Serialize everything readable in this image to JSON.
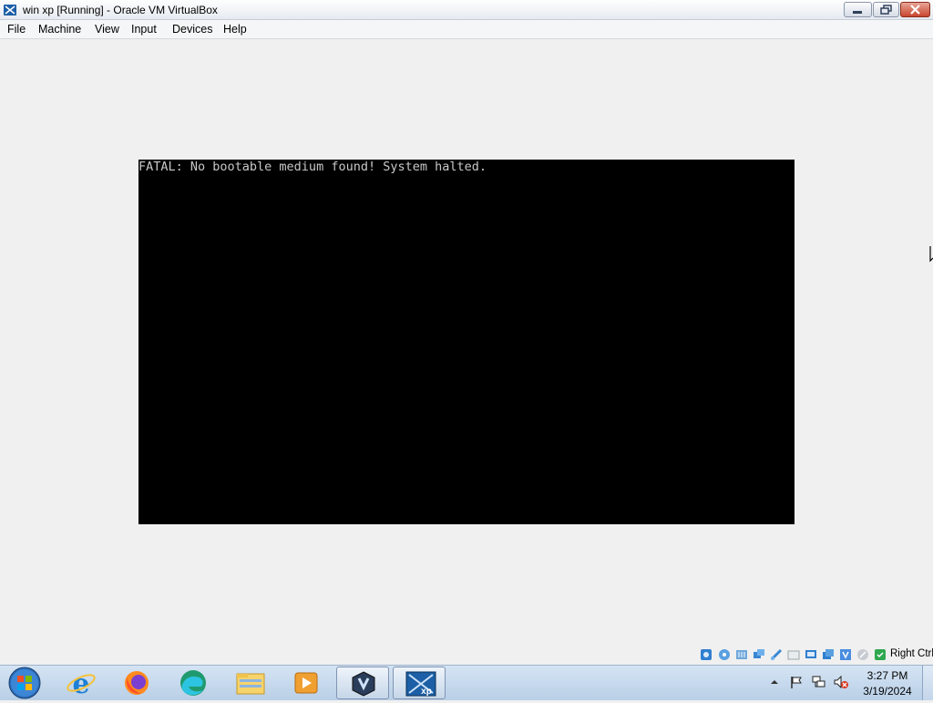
{
  "window": {
    "title": "win xp [Running] - Oracle VM VirtualBox",
    "icon": "virtualbox-icon"
  },
  "menu": {
    "items": [
      {
        "label": "File"
      },
      {
        "label": "Machine"
      },
      {
        "label": "View"
      },
      {
        "label": "Input"
      },
      {
        "label": "Devices"
      },
      {
        "label": "Help"
      }
    ]
  },
  "vm": {
    "message": "FATAL: No bootable medium found! System halted.",
    "background": "#000000",
    "text_color": "#c8c8c8"
  },
  "statusbar": {
    "icons": [
      "hard-disk-icon",
      "optical-drive-icon",
      "audio-icon",
      "network-icon",
      "usb-icon",
      "shared-folder-icon",
      "display-icon",
      "video-capture-icon",
      "virtualization-icon",
      "mouse-integration-icon",
      "keyboard-icon"
    ],
    "host_key": "Right Ctrl"
  },
  "taskbar": {
    "start": "windows-start-orb-icon",
    "apps": [
      "internet-explorer-icon",
      "firefox-icon",
      "edge-icon",
      "file-explorer-icon",
      "media-player-icon",
      "virtualbox-manager-icon",
      "virtualbox-vm-xp-icon"
    ],
    "clock": {
      "time": "3:27 PM",
      "date": "3/19/2024"
    },
    "tray": [
      "show-hidden-icons-icon",
      "action-center-flag-icon",
      "network-tray-icon",
      "volume-muted-icon"
    ]
  },
  "colors": {
    "titlebar": "#e6eaf0",
    "close_button": "#c8452f",
    "taskbar": "#b9cfe6",
    "client_area": "#f0f0f0"
  }
}
